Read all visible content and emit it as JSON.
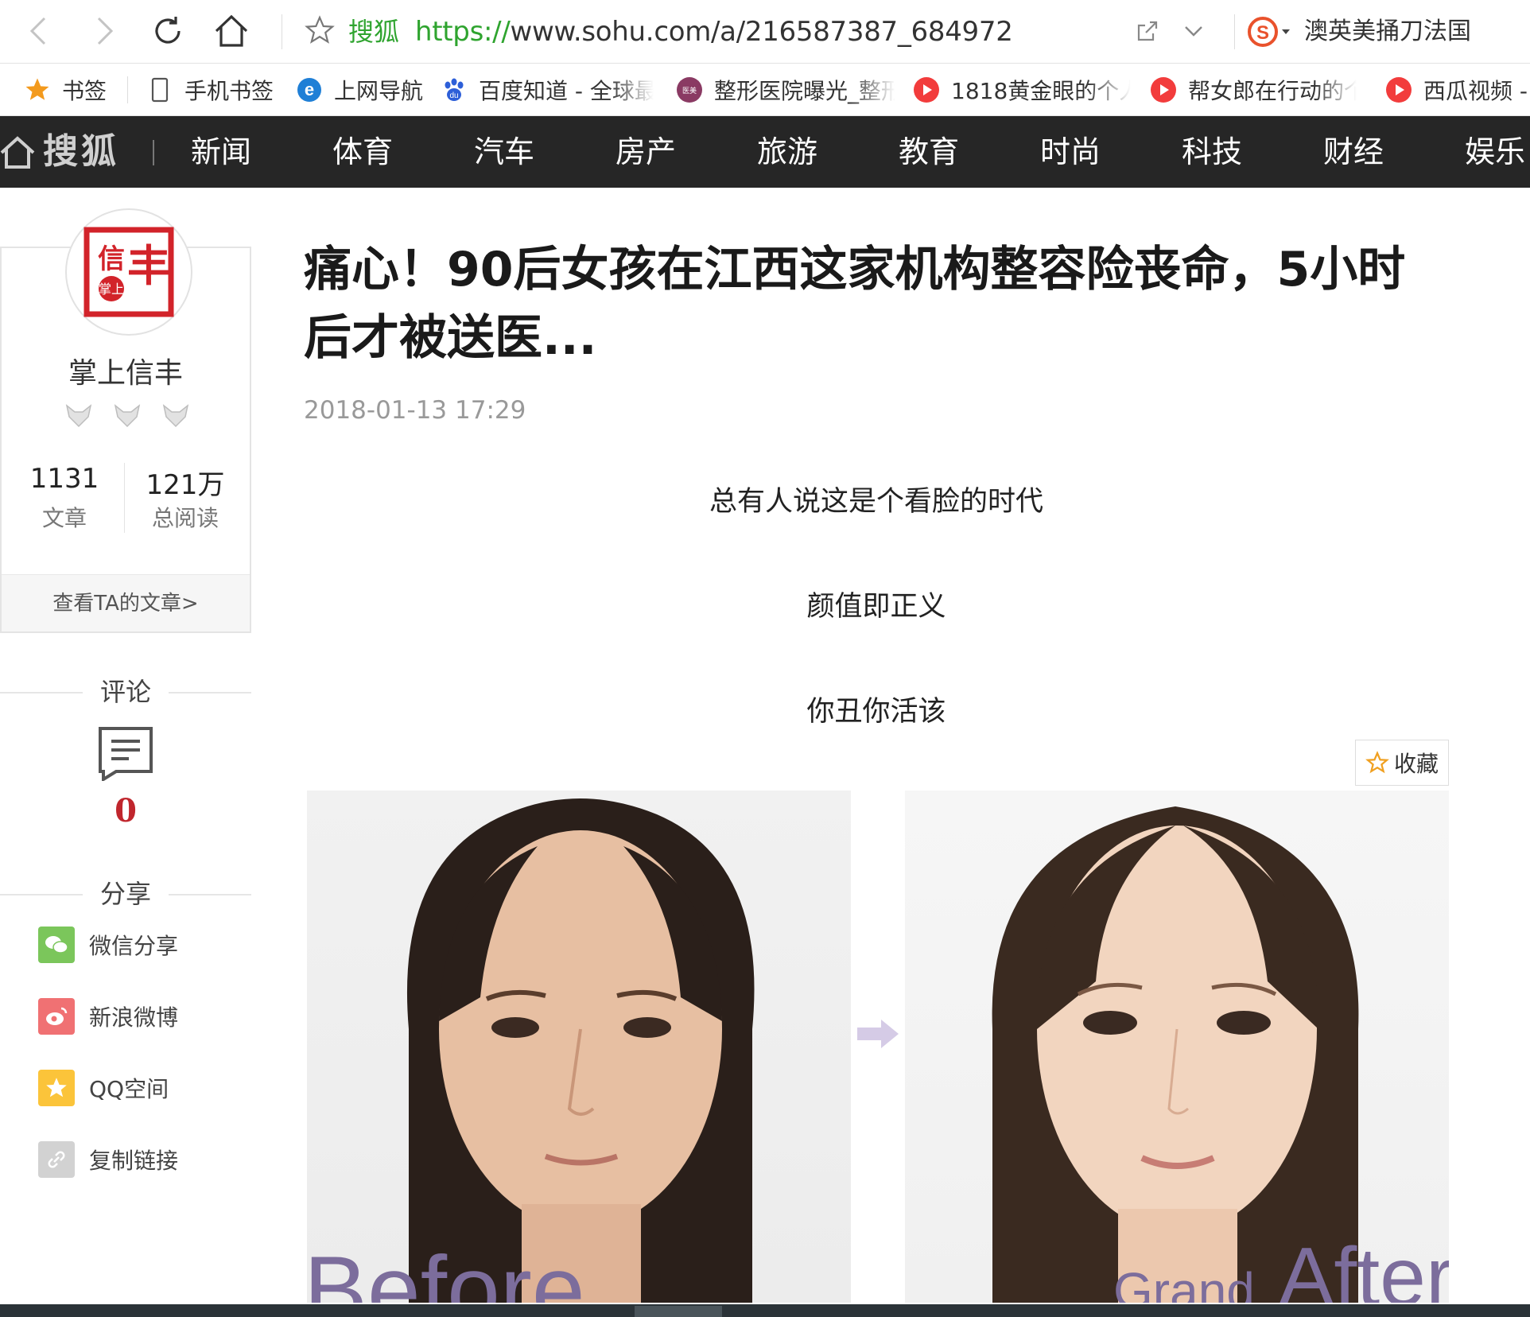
{
  "browser": {
    "site_name": "搜狐",
    "url_scheme": "https://",
    "url_rest": "www.sohu.com/a/216587387_684972",
    "search_query": "澳英美捅刀法国"
  },
  "bookmarks": [
    {
      "label": "书签"
    },
    {
      "label": "手机书签"
    },
    {
      "label": "上网导航"
    },
    {
      "label": "百度知道 - 全球最"
    },
    {
      "label": "整形医院曝光_整形"
    },
    {
      "label": "1818黄金眼的个人"
    },
    {
      "label": "帮女郎在行动的个"
    },
    {
      "label": "西瓜视频 -"
    }
  ],
  "sohu_nav": {
    "logo": "搜狐",
    "items": [
      "新闻",
      "体育",
      "汽车",
      "房产",
      "旅游",
      "教育",
      "时尚",
      "科技",
      "财经",
      "娱乐"
    ]
  },
  "author": {
    "avatar_text": "信丰",
    "name": "掌上信丰",
    "articles_count": "1131",
    "articles_label": "文章",
    "reads_count": "121万",
    "reads_label": "总阅读",
    "view_articles": "查看TA的文章>"
  },
  "comments": {
    "heading": "评论",
    "count": "0"
  },
  "share": {
    "heading": "分享",
    "items": [
      {
        "label": "微信分享",
        "color": "#7bc65b"
      },
      {
        "label": "新浪微博",
        "color": "#f07173"
      },
      {
        "label": "QQ空间",
        "color": "#fbc43a"
      },
      {
        "label": "复制链接",
        "color": "#d2d2d2"
      }
    ]
  },
  "article": {
    "title": "痛心！90后女孩在江西这家机构整容险丧命，5小时后才被送医...",
    "date": "2018-01-13 17:29",
    "paragraphs": [
      "总有人说这是个看脸的时代",
      "颜值即正义",
      "你丑你活该"
    ],
    "favorite_label": "收藏",
    "image_before_label": "Before",
    "image_after_label_prefix": "Grand",
    "image_after_label": "After"
  },
  "colors": {
    "nav_bg": "#262626",
    "accent_red": "#c0262d",
    "url_green": "#2fa42f"
  }
}
